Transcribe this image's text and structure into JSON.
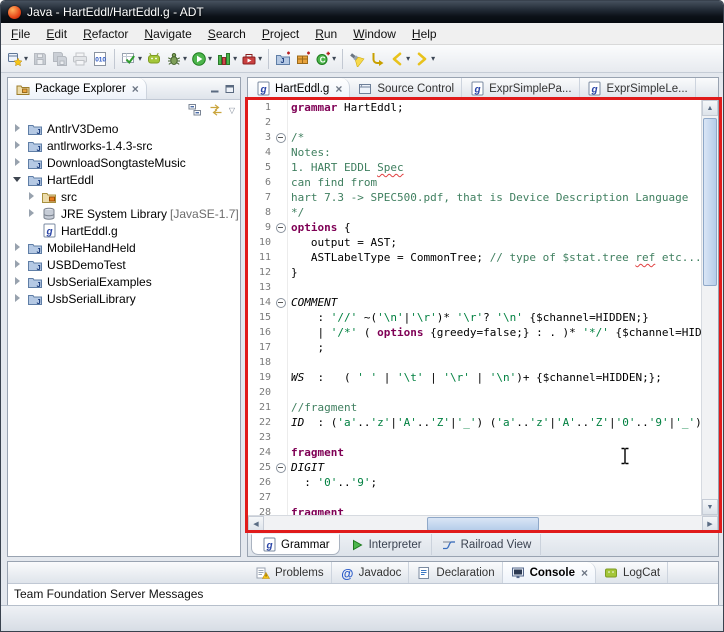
{
  "window": {
    "title": "Java - HartEddl/HartEddl.g - ADT"
  },
  "menu": {
    "items": [
      "File",
      "Edit",
      "Refactor",
      "Navigate",
      "Search",
      "Project",
      "Run",
      "Window",
      "Help"
    ]
  },
  "toolbar": {
    "buttons": [
      {
        "icon": "new-wizard",
        "dropdown": true
      },
      {
        "icon": "save",
        "disabled": true
      },
      {
        "icon": "save-all",
        "disabled": true
      },
      {
        "icon": "print",
        "disabled": true
      },
      {
        "icon": "binary-file"
      },
      {
        "divider": true
      },
      {
        "icon": "check-build",
        "dropdown": true
      },
      {
        "icon": "android-sdk"
      },
      {
        "icon": "debug",
        "dropdown": true
      },
      {
        "icon": "run",
        "dropdown": true
      },
      {
        "icon": "coverage",
        "dropdown": true
      },
      {
        "icon": "external-tools",
        "dropdown": true
      },
      {
        "divider": true
      },
      {
        "icon": "new-java-project"
      },
      {
        "icon": "new-package"
      },
      {
        "icon": "new-class",
        "dropdown": true
      },
      {
        "divider": true
      },
      {
        "icon": "search"
      },
      {
        "icon": "last-edit-location"
      },
      {
        "icon": "back",
        "dropdown": true
      },
      {
        "icon": "forward",
        "dropdown": true
      }
    ]
  },
  "package_explorer": {
    "title": "Package Explorer",
    "tree": [
      {
        "label": "AntlrV3Demo",
        "indent": 0,
        "state": "collapsed",
        "icon": "java-project"
      },
      {
        "label": "antlrworks-1.4.3-src",
        "indent": 0,
        "state": "collapsed",
        "icon": "java-project"
      },
      {
        "label": "DownloadSongtasteMusic",
        "indent": 0,
        "state": "collapsed",
        "icon": "java-project"
      },
      {
        "label": "HartEddl",
        "indent": 0,
        "state": "expanded",
        "icon": "java-project"
      },
      {
        "label": "src",
        "indent": 1,
        "state": "collapsed",
        "icon": "src-folder"
      },
      {
        "label": "JRE System Library",
        "suffix": " [JavaSE-1.7]",
        "indent": 1,
        "state": "collapsed",
        "icon": "jre-library"
      },
      {
        "label": "HartEddl.g",
        "indent": 1,
        "state": "leaf",
        "icon": "grammar-file"
      },
      {
        "label": "MobileHandHeld",
        "indent": 0,
        "state": "collapsed",
        "icon": "java-project"
      },
      {
        "label": "USBDemoTest",
        "indent": 0,
        "state": "collapsed",
        "icon": "java-project"
      },
      {
        "label": "UsbSerialExamples",
        "indent": 0,
        "state": "collapsed",
        "icon": "java-project"
      },
      {
        "label": "UsbSerialLibrary",
        "indent": 0,
        "state": "collapsed",
        "icon": "java-project"
      }
    ]
  },
  "editor": {
    "tabs": [
      {
        "label": "HartEddl.g",
        "icon": "grammar-file",
        "active": true,
        "closable": true
      },
      {
        "label": "Source Control",
        "icon": "source-control",
        "active": false
      },
      {
        "label": "ExprSimplePa...",
        "icon": "grammar-file",
        "active": false
      },
      {
        "label": "ExprSimpleLe...",
        "icon": "grammar-file",
        "active": false
      }
    ],
    "code": {
      "lines": [
        {
          "n": 1,
          "fold": false,
          "seg": [
            [
              "k",
              "grammar"
            ],
            [
              "d",
              " HartEddl;"
            ]
          ]
        },
        {
          "n": 2,
          "fold": false,
          "seg": []
        },
        {
          "n": 3,
          "fold": true,
          "seg": [
            [
              "c",
              "/*"
            ]
          ]
        },
        {
          "n": 4,
          "fold": false,
          "seg": [
            [
              "c",
              "Notes:"
            ]
          ]
        },
        {
          "n": 5,
          "fold": false,
          "seg": [
            [
              "c",
              "1. HART EDDL "
            ],
            [
              "cu",
              "Spec"
            ]
          ]
        },
        {
          "n": 6,
          "fold": false,
          "seg": [
            [
              "c",
              "can find from"
            ]
          ]
        },
        {
          "n": 7,
          "fold": false,
          "seg": [
            [
              "c",
              "hart 7.3 -> SPEC500.pdf, that is Device Description Language"
            ]
          ]
        },
        {
          "n": 8,
          "fold": false,
          "seg": [
            [
              "c",
              "*/"
            ]
          ]
        },
        {
          "n": 9,
          "fold": true,
          "seg": [
            [
              "k",
              "options"
            ],
            [
              "d",
              " {"
            ]
          ]
        },
        {
          "n": 10,
          "fold": false,
          "seg": [
            [
              "d",
              "   output = AST;"
            ]
          ]
        },
        {
          "n": 11,
          "fold": false,
          "seg": [
            [
              "d",
              "   ASTLabelType = CommonTree; "
            ],
            [
              "c",
              "// type of $stat.tree "
            ],
            [
              "cu",
              "ref"
            ],
            [
              "c",
              " etc..."
            ]
          ]
        },
        {
          "n": 12,
          "fold": false,
          "seg": [
            [
              "d",
              "}"
            ]
          ]
        },
        {
          "n": 13,
          "fold": false,
          "seg": []
        },
        {
          "n": 14,
          "fold": true,
          "seg": [
            [
              "i",
              "COMMENT"
            ]
          ]
        },
        {
          "n": 15,
          "fold": false,
          "seg": [
            [
              "d",
              "    : "
            ],
            [
              "s",
              "'//'"
            ],
            [
              "d",
              " ~("
            ],
            [
              "s",
              "'\\n'"
            ],
            [
              "d",
              "|"
            ],
            [
              "s",
              "'\\r'"
            ],
            [
              "d",
              ")* "
            ],
            [
              "s",
              "'\\r'"
            ],
            [
              "d",
              "? "
            ],
            [
              "s",
              "'\\n'"
            ],
            [
              "d",
              " {$channel=HIDDEN;}"
            ]
          ]
        },
        {
          "n": 16,
          "fold": false,
          "seg": [
            [
              "d",
              "    | "
            ],
            [
              "s",
              "'/*'"
            ],
            [
              "d",
              " ( "
            ],
            [
              "k",
              "options"
            ],
            [
              "d",
              " {greedy=false;} : . )* "
            ],
            [
              "s",
              "'*/'"
            ],
            [
              "d",
              " {$channel=HIDDEN;}"
            ]
          ]
        },
        {
          "n": 17,
          "fold": false,
          "seg": [
            [
              "d",
              "    ;"
            ]
          ]
        },
        {
          "n": 18,
          "fold": false,
          "seg": []
        },
        {
          "n": 19,
          "fold": false,
          "seg": [
            [
              "i",
              "WS"
            ],
            [
              "d",
              "  :   ( "
            ],
            [
              "s",
              "' '"
            ],
            [
              "d",
              " | "
            ],
            [
              "s",
              "'\\t'"
            ],
            [
              "d",
              " | "
            ],
            [
              "s",
              "'\\r'"
            ],
            [
              "d",
              " | "
            ],
            [
              "s",
              "'\\n'"
            ],
            [
              "d",
              ")+ {$channel=HIDDEN;};"
            ]
          ]
        },
        {
          "n": 20,
          "fold": false,
          "seg": []
        },
        {
          "n": 21,
          "fold": false,
          "seg": [
            [
              "c",
              "//fragment"
            ]
          ]
        },
        {
          "n": 22,
          "fold": false,
          "seg": [
            [
              "i",
              "ID"
            ],
            [
              "d",
              "  : ("
            ],
            [
              "s",
              "'a'"
            ],
            [
              "d",
              ".."
            ],
            [
              "s",
              "'z'"
            ],
            [
              "d",
              "|"
            ],
            [
              "s",
              "'A'"
            ],
            [
              "d",
              ".."
            ],
            [
              "s",
              "'Z'"
            ],
            [
              "d",
              "|"
            ],
            [
              "s",
              "'_'"
            ],
            [
              "d",
              ") ("
            ],
            [
              "s",
              "'a'"
            ],
            [
              "d",
              ".."
            ],
            [
              "s",
              "'z'"
            ],
            [
              "d",
              "|"
            ],
            [
              "s",
              "'A'"
            ],
            [
              "d",
              ".."
            ],
            [
              "s",
              "'Z'"
            ],
            [
              "d",
              "|"
            ],
            [
              "s",
              "'0'"
            ],
            [
              "d",
              ".."
            ],
            [
              "s",
              "'9'"
            ],
            [
              "d",
              "|"
            ],
            [
              "s",
              "'_'"
            ],
            [
              "d",
              ")*"
            ]
          ]
        },
        {
          "n": 23,
          "fold": false,
          "seg": []
        },
        {
          "n": 24,
          "fold": false,
          "seg": [
            [
              "k",
              "fragment"
            ]
          ]
        },
        {
          "n": 25,
          "fold": true,
          "seg": [
            [
              "i",
              "DIGIT"
            ]
          ]
        },
        {
          "n": 26,
          "fold": false,
          "seg": [
            [
              "d",
              "  : "
            ],
            [
              "s",
              "'0'"
            ],
            [
              "d",
              ".."
            ],
            [
              "s",
              "'9'"
            ],
            [
              "d",
              ";"
            ]
          ]
        },
        {
          "n": 27,
          "fold": false,
          "seg": []
        },
        {
          "n": 28,
          "fold": false,
          "seg": [
            [
              "k",
              "fragment"
            ]
          ]
        }
      ]
    },
    "bottom_tabs": [
      {
        "label": "Grammar",
        "icon": "grammar-tab",
        "active": true
      },
      {
        "label": "Interpreter",
        "icon": "interpreter",
        "active": false
      },
      {
        "label": "Railroad View",
        "icon": "railroad",
        "active": false
      }
    ]
  },
  "bottom_panel": {
    "tabs": [
      {
        "label": "Problems",
        "icon": "problems",
        "active": false
      },
      {
        "label": "Javadoc",
        "icon": "javadoc",
        "active": false
      },
      {
        "label": "Declaration",
        "icon": "declaration",
        "active": false
      },
      {
        "label": "Console",
        "icon": "console",
        "active": true,
        "closable": true
      },
      {
        "label": "LogCat",
        "icon": "logcat",
        "active": false
      }
    ],
    "console_message": "Team Foundation Server Messages"
  },
  "colors": {
    "annotation_red": "#e01b1b",
    "keyword": "#7F0055",
    "comment": "#3F7F5F",
    "literal": "#008040"
  }
}
